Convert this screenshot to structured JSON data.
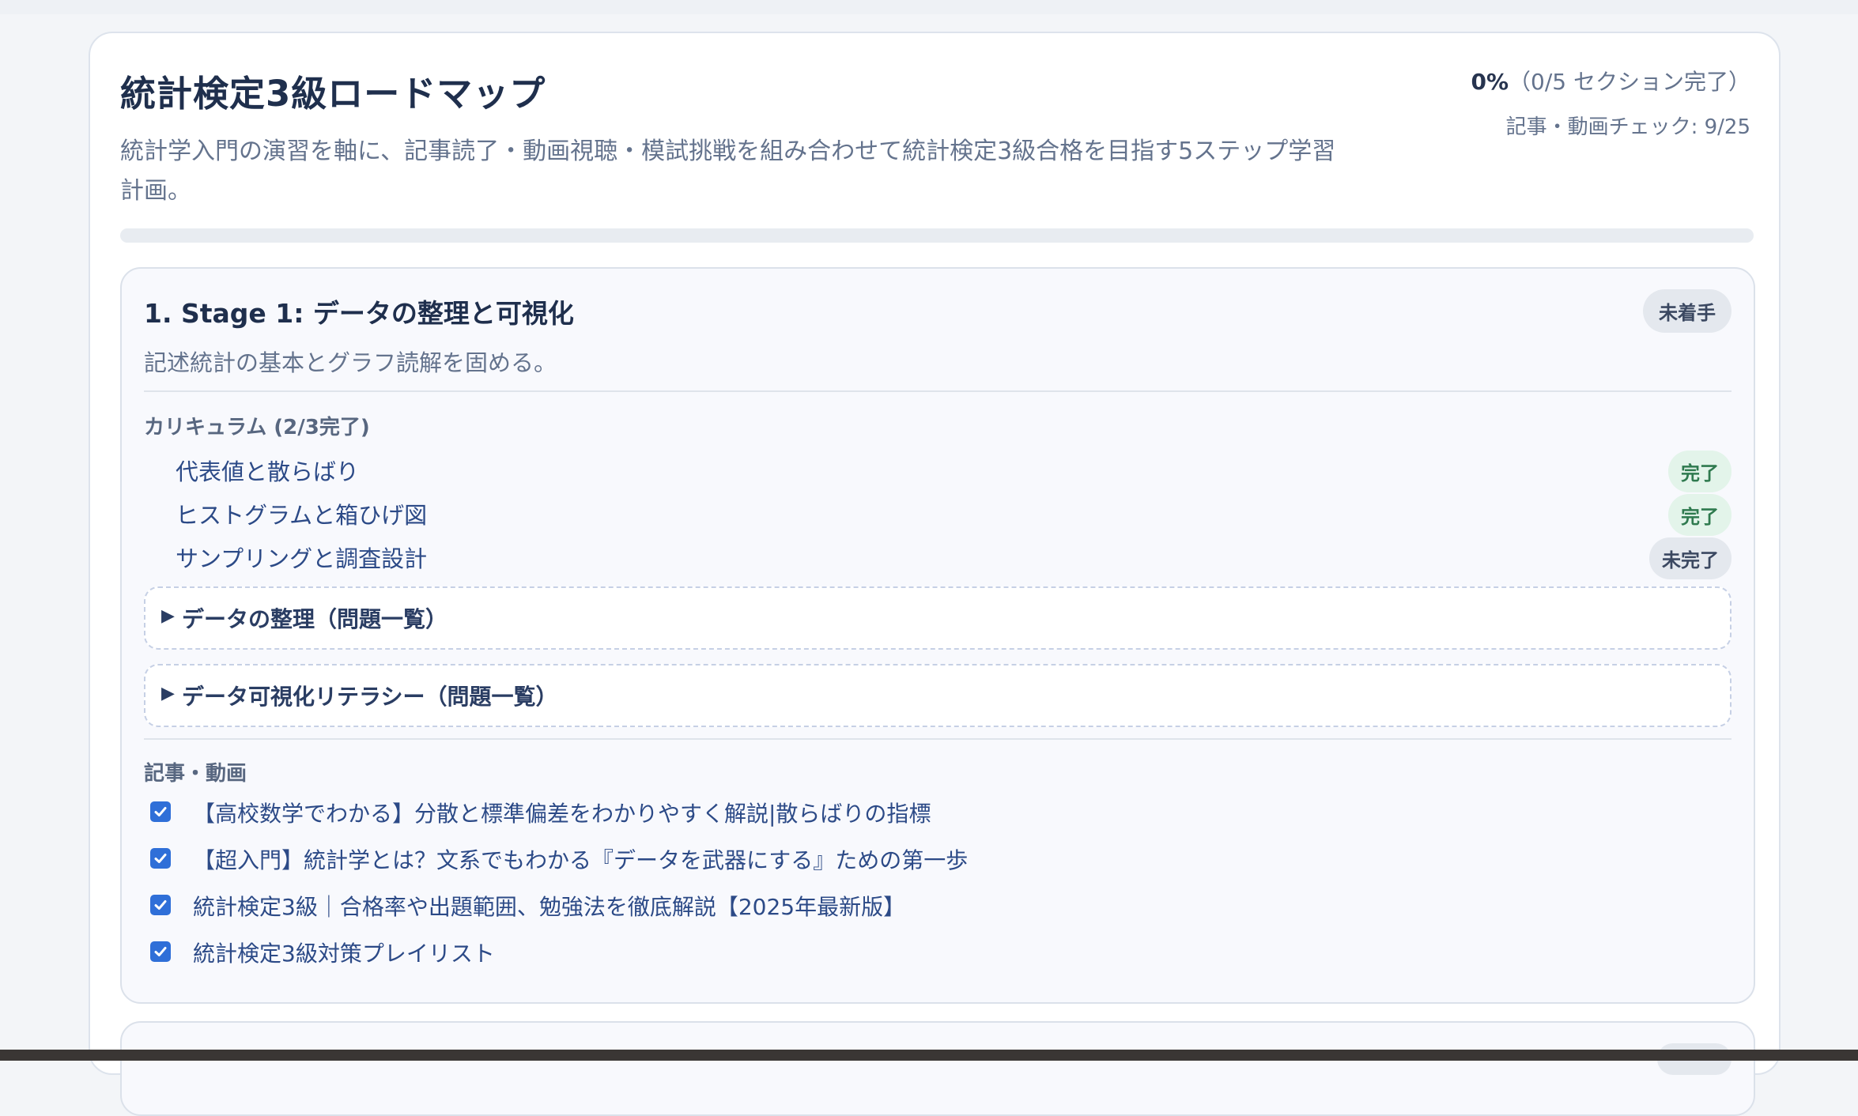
{
  "page": {
    "title": "統計検定3級ロードマップ",
    "description": "統計学入門の演習を軸に、記事読了・動画視聴・模試挑戦を組み合わせて統計検定3級合格を目指す5ステップ学習計画。",
    "progress_percent_label": "0%",
    "progress_detail": "（0/5 セクション完了）",
    "check_summary": "記事・動画チェック: 9/25",
    "progress_fraction": 0
  },
  "stage1": {
    "title": "1. Stage 1: データの整理と可視化",
    "status": "未着手",
    "description": "記述統計の基本とグラフ読解を固める。",
    "curriculum_heading": "カリキュラム (2/3完了)",
    "curriculum": [
      {
        "label": "代表値と散らばり",
        "status": "完了"
      },
      {
        "label": "ヒストグラムと箱ひげ図",
        "status": "完了"
      },
      {
        "label": "サンプリングと調査設計",
        "status": "未完了"
      }
    ],
    "problem_sets": [
      {
        "label": "データの整理（問題一覧）",
        "expanded": false
      },
      {
        "label": "データ可視化リテラシー（問題一覧）",
        "expanded": false
      }
    ],
    "media_heading": "記事・動画",
    "media": [
      {
        "label": "【高校数学でわかる】分散と標準偏差をわかりやすく解説|散らばりの指標",
        "checked": true
      },
      {
        "label": "【超入門】統計学とは？文系でもわかる『データを武器にする』ための第一歩",
        "checked": true
      },
      {
        "label": "統計検定3級｜合格率や出題範囲、勉強法を徹底解説【2025年最新版】",
        "checked": true
      },
      {
        "label": "統計検定3級対策プレイリスト",
        "checked": true
      }
    ]
  },
  "colors": {
    "accent": "#2f6fd8",
    "done_badge_bg": "#e3f4ea",
    "done_badge_text": "#2f7a4f",
    "neutral_badge_bg": "#e4e8ee"
  },
  "icons": {
    "collapsed_arrow": "▶",
    "checkbox": "checkbox-checked-icon"
  }
}
